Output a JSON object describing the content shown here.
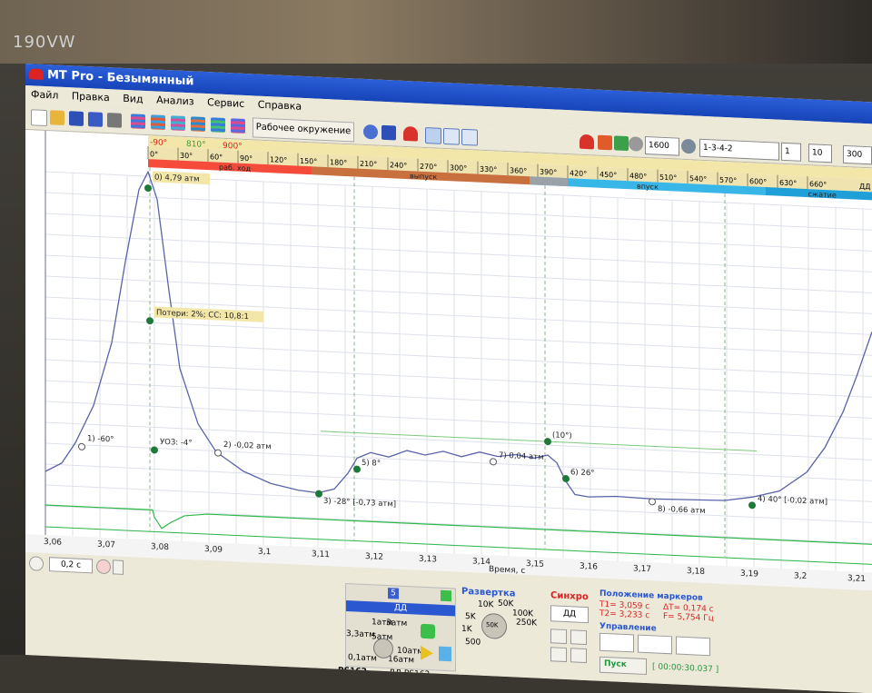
{
  "monitor": {
    "brand": "190VW"
  },
  "window": {
    "title": "MT Pro - Безымянный"
  },
  "menu": [
    "Файл",
    "Правка",
    "Вид",
    "Анализ",
    "Сервис",
    "Справка"
  ],
  "toolbar": {
    "environment": "Рабочее окружение",
    "zoom": "1600",
    "firing_order": "1-3-4-2",
    "right_val1": "1",
    "right_val2": "10",
    "right_val3": "300"
  },
  "angle_ruler": {
    "markers": [
      "-90°",
      "810°",
      "900°"
    ],
    "ticks": [
      "0°",
      "30°",
      "60°",
      "90°",
      "120°",
      "150°",
      "180°",
      "210°",
      "240°",
      "270°",
      "300°",
      "330°",
      "360°",
      "390°",
      "420°",
      "450°",
      "480°",
      "510°",
      "540°",
      "570°",
      "600°",
      "630°",
      "660°"
    ],
    "phases": [
      {
        "label": "раб. ход",
        "color": "#f44b3a"
      },
      {
        "label": "выпуск",
        "color": "#c9703f"
      },
      {
        "label": "впуск",
        "color": "#39b6e8"
      },
      {
        "label": "сжатие",
        "color": "#1e9fd8"
      }
    ],
    "dd": "ДД"
  },
  "annotations": [
    {
      "text": "0) 4,79 атм"
    },
    {
      "text": "Потери: 2%; СС: 10,8:1"
    },
    {
      "text": "1) -60°"
    },
    {
      "text": "УОЗ: -4°"
    },
    {
      "text": "2) -0,02 атм"
    },
    {
      "text": "3) -28° [-0,73 атм]"
    },
    {
      "text": "5) 8°"
    },
    {
      "text": "7) 0,04 атм"
    },
    {
      "text": "(10°)"
    },
    {
      "text": "6) 26°"
    },
    {
      "text": "8) -0,66 атм"
    },
    {
      "text": "4) 40° [-0,02 атм]"
    }
  ],
  "time_axis": {
    "label": "Время, с",
    "ticks": [
      "3,06",
      "3,07",
      "3,08",
      "3,09",
      "3,1",
      "3,11",
      "3,12",
      "3,13",
      "3,14",
      "3,15",
      "3,16",
      "3,17",
      "3,18",
      "3,19",
      "3,2",
      "3,21"
    ]
  },
  "time_scale": {
    "value": "0,2 с"
  },
  "channel_panel": {
    "channel_number": "5",
    "channel_name": "ДД",
    "sensor_left": "PS162",
    "sensor_right": "ДД PS162",
    "range_labels": [
      "1атм",
      "3,3атм",
      "5атм",
      "10атм",
      "16атм",
      "0,1атм",
      "3атм"
    ]
  },
  "sweep": {
    "title": "Развертка",
    "labels": [
      "10K",
      "50K",
      "100K",
      "250K",
      "5K",
      "1K",
      "500",
      "50K"
    ]
  },
  "sync": {
    "title": "Синхро",
    "value": "ДД"
  },
  "markers_pos": {
    "title": "Положение маркеров",
    "t1": "T1= 3,059 с",
    "t2": "T2= 3,233 с",
    "dt": "ΔT= 0,174 с",
    "f": "F= 5,754 Гц"
  },
  "control": {
    "title": "Управление",
    "start": "Пуск",
    "time": "[ 00:00:30.037 ]"
  },
  "colors": {
    "trace": "#5a64a8",
    "marker": "#1f7a3a",
    "sync_line": "#2fb84a",
    "title_bar": "#1e4fc7"
  }
}
